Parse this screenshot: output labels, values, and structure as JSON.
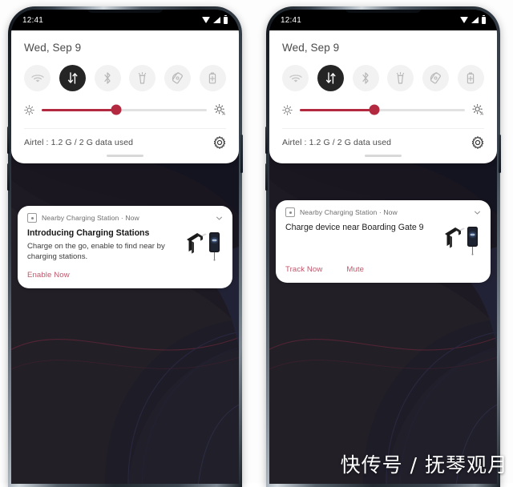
{
  "theme": {
    "accent": "#b32a40",
    "accent_soft": "#c0566a",
    "panel_bg": "#ffffff",
    "tile_off_bg": "#f2f2f2",
    "tile_on_bg": "#252525",
    "wallpaper_base": "#141420",
    "wallpaper_navy": "#1b1c33",
    "wallpaper_maroon": "#3a2028",
    "wallpaper_gray": "#4e5059",
    "frame_dark": "#1b2128"
  },
  "watermark": "快传号 / 抚琴观月",
  "phones": [
    {
      "id": "left",
      "status_bar": {
        "clock": "12:41",
        "icons": [
          "wifi-icon",
          "signal-icon",
          "battery-icon"
        ]
      },
      "quick_settings": {
        "date": "Wed, Sep 9",
        "tiles": [
          {
            "name": "wifi-tile",
            "icon": "wifi-icon",
            "state": "off"
          },
          {
            "name": "mobile-data-tile",
            "icon": "mobile-data-icon",
            "state": "on"
          },
          {
            "name": "bluetooth-tile",
            "icon": "bluetooth-icon",
            "state": "off"
          },
          {
            "name": "flashlight-tile",
            "icon": "flashlight-icon",
            "state": "off"
          },
          {
            "name": "auto-rotate-tile",
            "icon": "auto-rotate-icon",
            "state": "off"
          },
          {
            "name": "battery-saver-tile",
            "icon": "battery-saver-icon",
            "state": "off"
          }
        ],
        "brightness": {
          "value_percent": 45,
          "low_icon": "brightness-low-icon",
          "high_icon": "brightness-auto-icon"
        },
        "carrier_text": "Airtel : 1.2 G / 2 G data used",
        "settings_icon": "gear-icon"
      },
      "notification": {
        "app_name": "Nearby Charging Station · Now",
        "app_icon": "charging-station-app-icon",
        "expand_icon": "chevron-down-icon",
        "title": "Introducing Charging Stations",
        "body": "Charge on the go, enable to find near by charging stations.",
        "actions": [
          {
            "label": "Enable Now"
          }
        ],
        "image": "charging-dock-illustration"
      }
    },
    {
      "id": "right",
      "status_bar": {
        "clock": "12:41",
        "icons": [
          "wifi-icon",
          "signal-icon",
          "battery-icon"
        ]
      },
      "quick_settings": {
        "date": "Wed, Sep 9",
        "tiles": [
          {
            "name": "wifi-tile",
            "icon": "wifi-icon",
            "state": "off"
          },
          {
            "name": "mobile-data-tile",
            "icon": "mobile-data-icon",
            "state": "on"
          },
          {
            "name": "bluetooth-tile",
            "icon": "bluetooth-icon",
            "state": "off"
          },
          {
            "name": "flashlight-tile",
            "icon": "flashlight-icon",
            "state": "off"
          },
          {
            "name": "auto-rotate-tile",
            "icon": "auto-rotate-icon",
            "state": "off"
          },
          {
            "name": "battery-saver-tile",
            "icon": "battery-saver-icon",
            "state": "off"
          }
        ],
        "brightness": {
          "value_percent": 45,
          "low_icon": "brightness-low-icon",
          "high_icon": "brightness-auto-icon"
        },
        "carrier_text": "Airtel : 1.2 G / 2 G data used",
        "settings_icon": "gear-icon"
      },
      "notification": {
        "app_name": "Nearby Charging Station · Now",
        "app_icon": "charging-station-app-icon",
        "expand_icon": "chevron-down-icon",
        "title": "Charge device near Boarding Gate 9",
        "body": "",
        "actions": [
          {
            "label": "Track Now"
          },
          {
            "label": "Mute"
          }
        ],
        "image": "charging-dock-illustration"
      }
    }
  ]
}
